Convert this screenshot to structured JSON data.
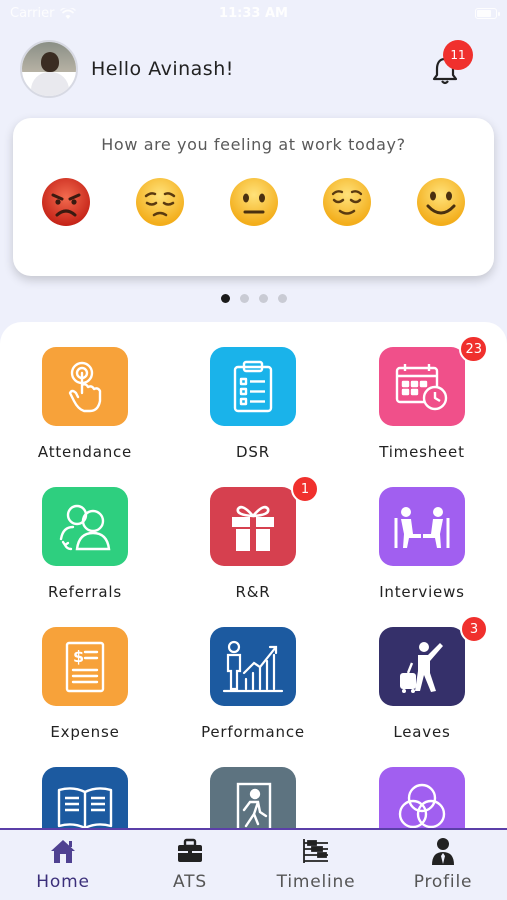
{
  "status_bar": {
    "carrier": "Carrier",
    "time": "11:33 AM"
  },
  "header": {
    "greeting": "Hello Avinash!",
    "notification_count": "11"
  },
  "mood": {
    "question": "How are you feeling at work today?",
    "emojis": [
      "angry-face-icon",
      "pensive-face-icon",
      "neutral-face-icon",
      "relieved-face-icon",
      "smiling-face-icon"
    ]
  },
  "carousel": {
    "pages": 4,
    "active": 0
  },
  "tiles": [
    {
      "label": "Attendance",
      "color": "#f7a23a",
      "icon": "touch-hand-icon",
      "badge": ""
    },
    {
      "label": "DSR",
      "color": "#1ab3ea",
      "icon": "clipboard-icon",
      "badge": ""
    },
    {
      "label": "Timesheet",
      "color": "#f0508a",
      "icon": "calendar-clock-icon",
      "badge": "23"
    },
    {
      "label": "Referrals",
      "color": "#2ecf7f",
      "icon": "users-icon",
      "badge": ""
    },
    {
      "label": "R&R",
      "color": "#d6404f",
      "icon": "gift-icon",
      "badge": "1"
    },
    {
      "label": "Interviews",
      "color": "#a15ff0",
      "icon": "interview-chairs-icon",
      "badge": ""
    },
    {
      "label": "Expense",
      "color": "#f7a23a",
      "icon": "receipt-dollar-icon",
      "badge": ""
    },
    {
      "label": "Performance",
      "color": "#1c5aa0",
      "icon": "growth-chart-icon",
      "badge": ""
    },
    {
      "label": "Leaves",
      "color": "#35306a",
      "icon": "traveler-icon",
      "badge": "3"
    },
    {
      "label": "",
      "color": "#1c5aa0",
      "icon": "book-icon",
      "badge": ""
    },
    {
      "label": "",
      "color": "#5d7380",
      "icon": "exit-door-icon",
      "badge": ""
    },
    {
      "label": "",
      "color": "#a15ff0",
      "icon": "circles-icon",
      "badge": ""
    }
  ],
  "tabbar": {
    "tabs": [
      {
        "label": "Home",
        "icon": "home-icon",
        "active": true
      },
      {
        "label": "ATS",
        "icon": "briefcase-icon",
        "active": false
      },
      {
        "label": "Timeline",
        "icon": "timeline-icon",
        "active": false
      },
      {
        "label": "Profile",
        "icon": "person-icon",
        "active": false
      }
    ]
  },
  "colors": {
    "accent": "#3b2f7a",
    "badge": "#f0302d",
    "background": "#eef0fb"
  }
}
